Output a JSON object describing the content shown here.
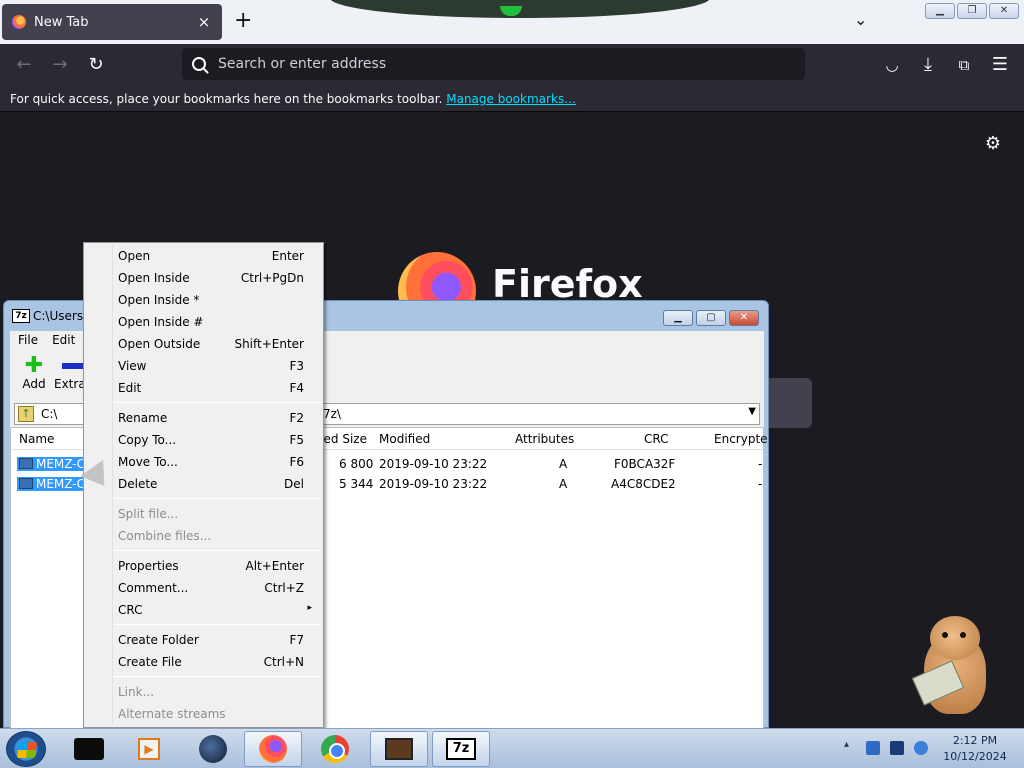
{
  "firefox": {
    "tab_title": "New Tab",
    "tab_close": "×",
    "new_tab": "+",
    "tabs_list": "⌄",
    "url_placeholder": "Search or enter address",
    "bookmarks_text": "For quick access, place your bookmarks here on the bookmarks toolbar.",
    "bookmarks_link": "Manage bookmarks…",
    "wordmark": "Firefox"
  },
  "zip": {
    "title": "C:\\Users\\",
    "app_icon": "7z",
    "menu": [
      "File",
      "Edit"
    ],
    "toolbar": {
      "add": "Add",
      "extract": "Extrac"
    },
    "address_prefix": "C:\\",
    "address_suffix": "7z\\",
    "columns": {
      "name": "Name",
      "packed": "ked Size",
      "modified": "Modified",
      "attributes": "Attributes",
      "crc": "CRC",
      "encrypted": "Encrypte"
    },
    "rows": [
      {
        "name": "MEMZ-C",
        "packed": "6 800",
        "modified": "2019-09-10 23:22",
        "attributes": "A",
        "crc": "F0BCA32F",
        "enc": "-"
      },
      {
        "name": "MEMZ-C",
        "packed": "5 344",
        "modified": "2019-09-10 23:22",
        "attributes": "A",
        "crc": "A4C8CDE2",
        "enc": "-"
      }
    ]
  },
  "context_menu": {
    "items": [
      {
        "label": "Open",
        "key": "Enter"
      },
      {
        "label": "Open Inside",
        "key": "Ctrl+PgDn"
      },
      {
        "label": "Open Inside *",
        "key": ""
      },
      {
        "label": "Open Inside #",
        "key": ""
      },
      {
        "label": "Open Outside",
        "key": "Shift+Enter"
      },
      {
        "label": "View",
        "key": "F3"
      },
      {
        "label": "Edit",
        "key": "F4"
      },
      {
        "label": "Rename",
        "key": "F2"
      },
      {
        "label": "Copy To...",
        "key": "F5"
      },
      {
        "label": "Move To...",
        "key": "F6"
      },
      {
        "label": "Delete",
        "key": "Del"
      },
      {
        "label": "Split file...",
        "key": ""
      },
      {
        "label": "Combine files...",
        "key": ""
      },
      {
        "label": "Properties",
        "key": "Alt+Enter"
      },
      {
        "label": "Comment...",
        "key": "Ctrl+Z"
      },
      {
        "label": "CRC",
        "key": ""
      },
      {
        "label": "Create Folder",
        "key": "F7"
      },
      {
        "label": "Create File",
        "key": "Ctrl+N"
      },
      {
        "label": "Link...",
        "key": ""
      },
      {
        "label": "Alternate streams",
        "key": ""
      }
    ],
    "submenu_arrow": "▸"
  },
  "taskbar": {
    "app_7z": "7z",
    "tray_arrow": "▴",
    "time": "2:12 PM",
    "date": "10/12/2024"
  },
  "colors": {
    "firefox_bg": "#1c1b22",
    "selection": "#3399ff",
    "link": "#00ddff"
  }
}
